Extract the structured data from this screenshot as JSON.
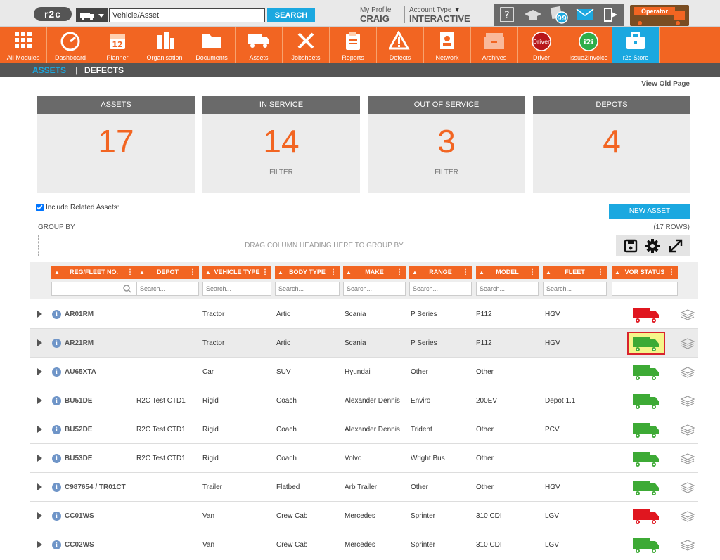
{
  "header": {
    "logo": "r2c",
    "search_placeholder": "Vehicle/Asset",
    "search_button": "SEARCH",
    "my_profile": "My Profile",
    "user": "CRAIG",
    "account_type_label": "Account Type",
    "account_type": "INTERACTIVE",
    "badge": "99",
    "operator": "Operator"
  },
  "nav": [
    {
      "label": "All Modules",
      "icon": "grid-icon"
    },
    {
      "label": "Dashboard",
      "icon": "speedometer-icon"
    },
    {
      "label": "Planner",
      "icon": "calendar-icon",
      "day": "12"
    },
    {
      "label": "Organisation",
      "icon": "building-icon"
    },
    {
      "label": "Documents",
      "icon": "folder-icon"
    },
    {
      "label": "Assets",
      "icon": "truck-icon"
    },
    {
      "label": "Jobsheets",
      "icon": "tools-icon"
    },
    {
      "label": "Reports",
      "icon": "clipboard-icon"
    },
    {
      "label": "Defects",
      "icon": "warning-icon"
    },
    {
      "label": "Network",
      "icon": "contact-icon"
    },
    {
      "label": "Archives",
      "icon": "archive-icon"
    },
    {
      "label": "Driver",
      "icon": "driver-icon",
      "badge": "Driver"
    },
    {
      "label": "Issue2Invoice",
      "icon": "i2i-icon",
      "badge": "i2i"
    },
    {
      "label": "r2c Store",
      "icon": "briefcase-icon"
    }
  ],
  "subnav": {
    "assets": "ASSETS",
    "sep": "|",
    "defects": "DEFECTS"
  },
  "view_old": "View Old Page",
  "cards": [
    {
      "title": "ASSETS",
      "value": "17",
      "filter": ""
    },
    {
      "title": "IN SERVICE",
      "value": "14",
      "filter": "FILTER"
    },
    {
      "title": "OUT OF SERVICE",
      "value": "3",
      "filter": "FILTER"
    },
    {
      "title": "DEPOTS",
      "value": "4",
      "filter": ""
    }
  ],
  "include_related": "Include Related Assets:",
  "new_asset": "NEW ASSET",
  "group_by": "GROUP BY",
  "row_count": "(17 ROWS)",
  "drop_zone": "DRAG COLUMN HEADING HERE TO GROUP BY",
  "columns": [
    "REG/FLEET NO.",
    "DEPOT",
    "VEHICLE TYPE",
    "BODY TYPE",
    "MAKE",
    "RANGE",
    "MODEL",
    "FLEET",
    "VOR STATUS"
  ],
  "filter_placeholder": "Search...",
  "colors": {
    "orange": "#f26522",
    "blue": "#1ba8e0",
    "vor_red": "#e0161f",
    "vor_green": "#3daa35"
  },
  "rows": [
    {
      "reg": "AR01RM",
      "depot": "",
      "vtype": "Tractor",
      "body": "Artic",
      "make": "Scania",
      "range": "P Series",
      "model": "P112",
      "fleet": "HGV",
      "vor": "red"
    },
    {
      "reg": "AR21RM",
      "depot": "",
      "vtype": "Tractor",
      "body": "Artic",
      "make": "Scania",
      "range": "P Series",
      "model": "P112",
      "fleet": "HGV",
      "vor": "green"
    },
    {
      "reg": "AU65XTA",
      "depot": "",
      "vtype": "Car",
      "body": "SUV",
      "make": "Hyundai",
      "range": "Other",
      "model": "Other",
      "fleet": "",
      "vor": "green"
    },
    {
      "reg": "BU51DE",
      "depot": "R2C Test CTD1",
      "vtype": "Rigid",
      "body": "Coach",
      "make": "Alexander Dennis",
      "range": "Enviro",
      "model": "200EV",
      "fleet": "Depot 1.1",
      "vor": "green"
    },
    {
      "reg": "BU52DE",
      "depot": "R2C Test CTD1",
      "vtype": "Rigid",
      "body": "Coach",
      "make": "Alexander Dennis",
      "range": "Trident",
      "model": "Other",
      "fleet": "PCV",
      "vor": "green"
    },
    {
      "reg": "BU53DE",
      "depot": "R2C Test CTD1",
      "vtype": "Rigid",
      "body": "Coach",
      "make": "Volvo",
      "range": "Wright Bus",
      "model": "Other",
      "fleet": "",
      "vor": "green"
    },
    {
      "reg": "C987654 / TR01CT",
      "depot": "",
      "vtype": "Trailer",
      "body": "Flatbed",
      "make": "Arb Trailer",
      "range": "Other",
      "model": "Other",
      "fleet": "HGV",
      "vor": "green"
    },
    {
      "reg": "CC01WS",
      "depot": "",
      "vtype": "Van",
      "body": "Crew Cab",
      "make": "Mercedes",
      "range": "Sprinter",
      "model": "310 CDI",
      "fleet": "LGV",
      "vor": "red"
    },
    {
      "reg": "CC02WS",
      "depot": "",
      "vtype": "Van",
      "body": "Crew Cab",
      "make": "Mercedes",
      "range": "Sprinter",
      "model": "310 CDI",
      "fleet": "LGV",
      "vor": "green"
    }
  ]
}
